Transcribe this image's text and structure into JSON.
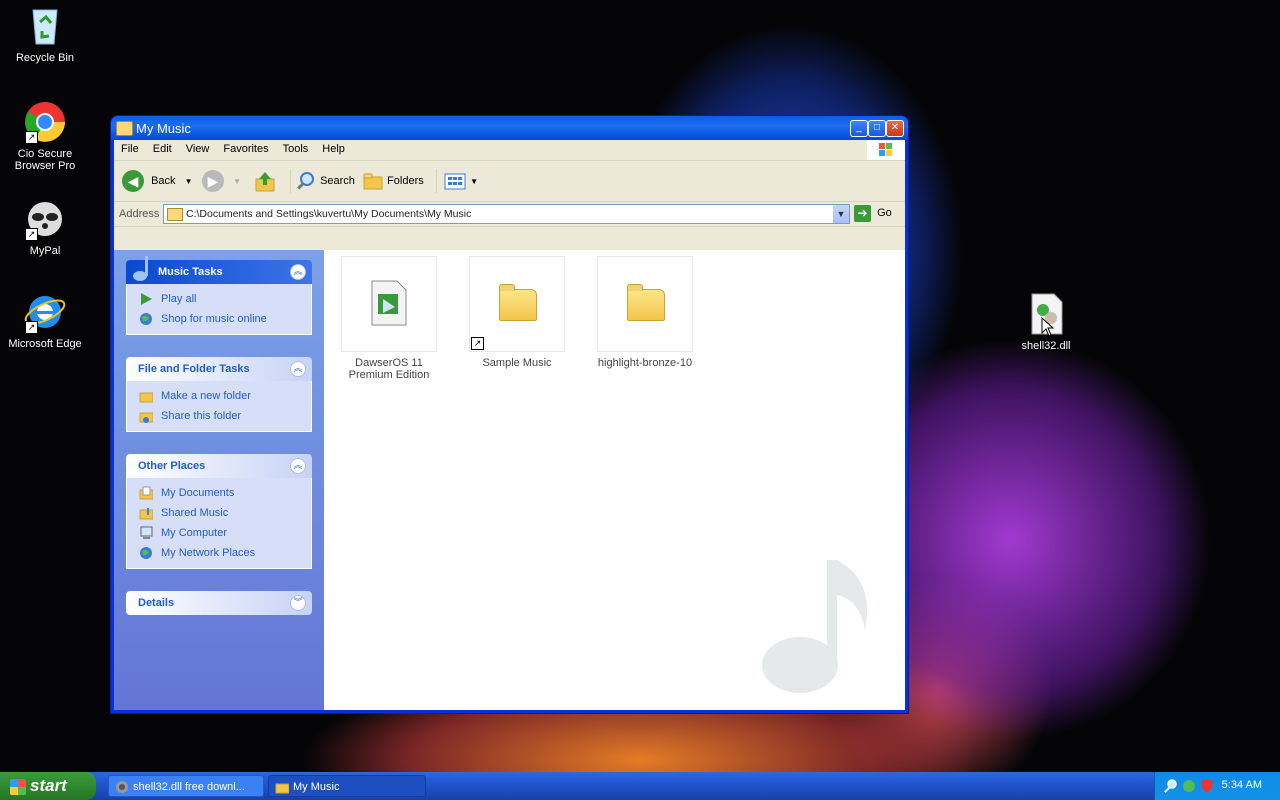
{
  "desktop": {
    "icons": [
      {
        "label": "Recycle Bin",
        "icon": "recycle-bin-icon"
      },
      {
        "label": "Cio Secure Browser Pro",
        "icon": "chrome-browser-icon"
      },
      {
        "label": "MyPal",
        "icon": "mypal-raccoon-icon"
      },
      {
        "label": "Microsoft Edge",
        "icon": "internet-explorer-icon"
      },
      {
        "label": "shell32.dll",
        "icon": "dll-file-icon"
      }
    ]
  },
  "window": {
    "title": "My Music",
    "menu": [
      "File",
      "Edit",
      "View",
      "Favorites",
      "Tools",
      "Help"
    ],
    "toolbar": {
      "back": "Back",
      "search": "Search",
      "folders": "Folders"
    },
    "address": {
      "label": "Address",
      "path": "C:\\Documents and Settings\\kuvertu\\My Documents\\My Music",
      "go": "Go"
    },
    "panels": {
      "music_tasks": {
        "title": "Music Tasks",
        "items": [
          "Play all",
          "Shop for music online"
        ]
      },
      "file_tasks": {
        "title": "File and Folder Tasks",
        "items": [
          "Make a new folder",
          "Share this folder"
        ]
      },
      "other_places": {
        "title": "Other Places",
        "items": [
          "My Documents",
          "Shared Music",
          "My Computer",
          "My Network Places"
        ]
      },
      "details": {
        "title": "Details"
      }
    },
    "files": [
      {
        "name": "DawserOS 11 Premium Edition",
        "type": "media-file"
      },
      {
        "name": "Sample Music",
        "type": "folder-shortcut"
      },
      {
        "name": "highlight-bronze-10",
        "type": "folder"
      }
    ]
  },
  "taskbar": {
    "start": "start",
    "tasks": [
      "shell32.dll free downl...",
      "My Music"
    ],
    "clock": "5:34 AM"
  },
  "colors": {
    "taskbar": "#245edb",
    "start": "#2f8a2f",
    "panel_link": "#215dc6",
    "title_bar": "#0a5ee6"
  }
}
